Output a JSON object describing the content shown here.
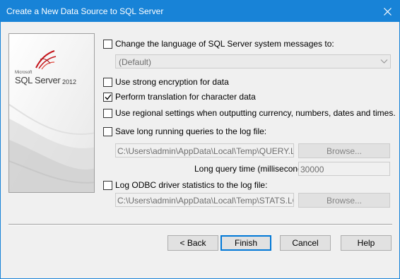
{
  "window": {
    "title": "Create a New Data Source to SQL Server",
    "close_icon": "close-icon"
  },
  "logo": {
    "microsoft": "Microsoft",
    "product": "SQL Server",
    "year": "2012"
  },
  "options": {
    "change_language": {
      "label": "Change the language of SQL Server system messages to:",
      "checked": false
    },
    "language_select": {
      "value": "(Default)"
    },
    "strong_encryption": {
      "label": "Use strong encryption for data",
      "checked": false
    },
    "translation": {
      "label": "Perform translation for character data",
      "checked": true
    },
    "regional_settings": {
      "label": "Use regional settings when outputting currency, numbers, dates and times.",
      "checked": false
    },
    "save_long_queries": {
      "label": "Save long running queries to the log file:",
      "checked": false
    },
    "query_log_path": "C:\\Users\\admin\\AppData\\Local\\Temp\\QUERY.LOG",
    "query_browse": "Browse...",
    "long_query_time_label": "Long query time (milliseconds):",
    "long_query_time_value": "30000",
    "log_odbc_stats": {
      "label": "Log ODBC driver statistics to the log file:",
      "checked": false
    },
    "stats_log_path": "C:\\Users\\admin\\AppData\\Local\\Temp\\STATS.LOG",
    "stats_browse": "Browse..."
  },
  "buttons": {
    "back": "< Back",
    "finish": "Finish",
    "cancel": "Cancel",
    "help": "Help"
  }
}
